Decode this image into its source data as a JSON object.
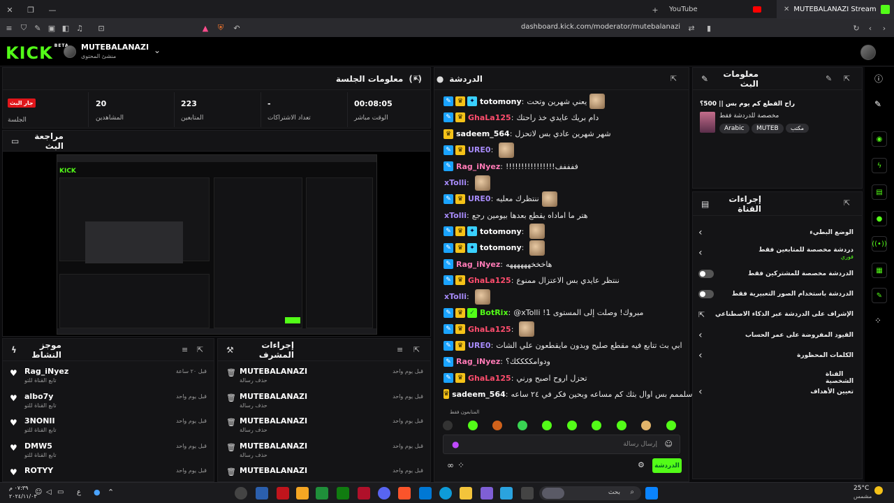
{
  "browser": {
    "tabs": [
      {
        "label": "YouTube"
      },
      {
        "label": "MUTEBALANAZI Stream - Kick D"
      }
    ],
    "url": "dashboard.kick.com/moderator/mutebalanazi"
  },
  "header": {
    "logo": "KICK",
    "logo_sup": "BETA",
    "channel_name": "MUTEBALANAZI",
    "channel_role": "منشئ المحتوى"
  },
  "session": {
    "title": "معلومات الجلسة",
    "live_badge": "جار البث",
    "live_label": "الجلسة",
    "stats": [
      {
        "value": "20",
        "label": "المشاهدين"
      },
      {
        "value": "223",
        "label": "المتابعين"
      },
      {
        "value": "-",
        "label": "تعداد الاشتراكات"
      },
      {
        "value": "00:08:05",
        "label": "الوقت مباشر"
      }
    ]
  },
  "preview": {
    "title": "مراجعة البث"
  },
  "activity": {
    "title": "موجز النشاط",
    "items": [
      {
        "name": "Rag_iNyez",
        "sub": "تابع القناة للتو",
        "time": "قبل ٢٠ ساعة"
      },
      {
        "name": "albo7y",
        "sub": "تابع القناة للتو",
        "time": "قبل يوم واحد"
      },
      {
        "name": "3NONII",
        "sub": "تابع القناة للتو",
        "time": "قبل يوم واحد"
      },
      {
        "name": "DMW5",
        "sub": "تابع القناة للتو",
        "time": "قبل يوم واحد"
      },
      {
        "name": "ROTYY",
        "sub": "",
        "time": "قبل يوم واحد"
      }
    ]
  },
  "modactions": {
    "title": "إجراءات المشرف",
    "items": [
      {
        "name": "MUTEBALANAZI",
        "sub": "حذف رسالة",
        "time": "قبل يوم واحد"
      },
      {
        "name": "MUTEBALANAZI",
        "sub": "حذف رسالة",
        "time": "قبل يوم واحد"
      },
      {
        "name": "MUTEBALANAZI",
        "sub": "حذف رسالة",
        "time": "قبل يوم واحد"
      },
      {
        "name": "MUTEBALANAZI",
        "sub": "حذف رسالة",
        "time": "قبل يوم واحد"
      },
      {
        "name": "MUTEBALANAZI",
        "sub": "",
        "time": "قبل يوم واحد"
      }
    ]
  },
  "chat": {
    "title": "الدردشة",
    "messages": [
      {
        "user": "totomony",
        "color": "#ffffff",
        "badges": [
          "mod",
          "crown",
          "vip"
        ],
        "text": "يعني شهرين وتحت"
      },
      {
        "user": "GhaLa125",
        "color": "#ff4d6d",
        "badges": [
          "mod",
          "crown"
        ],
        "text": "دام بريك عايدي خذ راحتك"
      },
      {
        "user": "sadeem_564",
        "color": "#ffffff",
        "badges": [
          "crown"
        ],
        "text": "شهر شهرين عادي بس لاتحزل"
      },
      {
        "user": "URE0",
        "color": "#a78bfa",
        "badges": [
          "mod",
          "crown"
        ],
        "text": ""
      },
      {
        "user": "Rag_iNyez",
        "color": "#ff7ab6",
        "badges": [
          "mod"
        ],
        "text": "!!!!!!!!!!!!!!!!ففففف"
      },
      {
        "user": "xTolli",
        "color": "#a78bfa",
        "badges": [],
        "text": ""
      },
      {
        "user": "URE0",
        "color": "#a78bfa",
        "badges": [
          "mod",
          "crown"
        ],
        "text": "ننتظرك معليه"
      },
      {
        "user": "xTolli",
        "color": "#a78bfa",
        "badges": [],
        "text": "هتر ما اماداه يقطع بعدها بيومين رجع"
      },
      {
        "user": "totomony",
        "color": "#ffffff",
        "badges": [
          "mod",
          "crown",
          "vip"
        ],
        "text": ""
      },
      {
        "user": "totomony",
        "color": "#ffffff",
        "badges": [
          "mod",
          "crown",
          "vip"
        ],
        "text": ""
      },
      {
        "user": "Rag_iNyez",
        "color": "#ff7ab6",
        "badges": [
          "mod"
        ],
        "text": "هاخخخههههههه"
      },
      {
        "user": "GhaLa125",
        "color": "#ff4d6d",
        "badges": [
          "mod",
          "crown"
        ],
        "text": "ننتظر عايدي بس الاعتزال ممنوع"
      },
      {
        "user": "xTolli",
        "color": "#a78bfa",
        "badges": [],
        "text": ""
      },
      {
        "user": "BotRix",
        "color": "#53fc18",
        "badges": [
          "mod",
          "crown",
          "green"
        ],
        "text": "@xTolli !مبروك! وصلت إلى المستوى 1"
      },
      {
        "user": "GhaLa125",
        "color": "#ff4d6d",
        "badges": [
          "mod",
          "crown"
        ],
        "text": ""
      },
      {
        "user": "URE0",
        "color": "#a78bfa",
        "badges": [
          "mod",
          "crown"
        ],
        "text": "ابي بث تتابع فيه مقطع صليح وبدون مايقطعون علي الشات"
      },
      {
        "user": "Rag_iNyez",
        "color": "#ff7ab6",
        "badges": [
          "mod"
        ],
        "text": "ودوامككككك؟"
      },
      {
        "user": "GhaLa125",
        "color": "#ff4d6d",
        "badges": [
          "mod",
          "crown"
        ],
        "text": "تحزل اروح اصبح ورني"
      },
      {
        "user": "sadeem_564",
        "color": "#ffffff",
        "badges": [
          "crown"
        ],
        "text": "اسلممم بس اوال بثك كم مساعه وبحين فكر في ٢٤ ساعه"
      }
    ],
    "followers_only": "المتابعون فقط",
    "input_placeholder": "إرسال رسالة",
    "send_label": "الدردشة"
  },
  "stream_info": {
    "title": "معلومات البث",
    "stream_title": "راح القطع كم يوم بس || 500؟",
    "category": "مخصصة للدردشة فقط",
    "tags": [
      "Arabic",
      "MUTEB",
      "مكتب"
    ]
  },
  "channel_actions": {
    "title": "إجراءات القناة",
    "items": [
      {
        "label": "الوضع البطيء",
        "control": "chevron",
        "sub": ""
      },
      {
        "label": "دردشة مخصصة للمتابعين فقط",
        "control": "chevron",
        "sub": "فوري"
      },
      {
        "label": "الدردشة مخصصة للمشتركين فقط",
        "control": "toggle",
        "sub": ""
      },
      {
        "label": "الدردشة باستخدام الصور التعبيرية فقط",
        "control": "toggle",
        "sub": ""
      },
      {
        "label": "الإشراف على الدردشة عبر الذكاء الاصطناعي",
        "control": "external",
        "sub": ""
      },
      {
        "label": "القيود المفروضة على عمر الحساب",
        "control": "chevron",
        "sub": ""
      },
      {
        "label": "الكلمات المحظورة",
        "control": "chevron",
        "sub": ""
      }
    ],
    "section": "القناة الشخصية",
    "goals": "تعيين الأهداف"
  },
  "taskbar": {
    "time": "٠٧:٣٩ م",
    "date": "٢٠٢٤/١١/٠٣",
    "lang": "ع",
    "search_placeholder": "بحث",
    "weather_temp": "25°C",
    "weather_desc": "مشمس"
  }
}
